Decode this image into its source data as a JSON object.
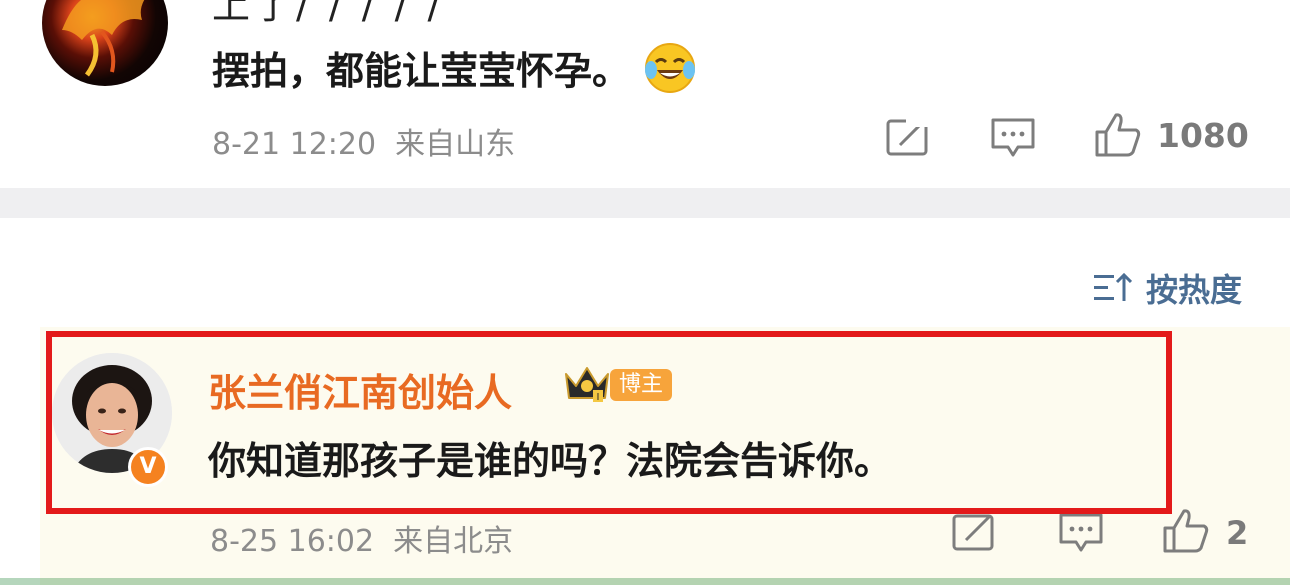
{
  "comment1": {
    "top_partial_text": "上了/ / / / /",
    "text": "摆拍，都能让莹莹怀孕。",
    "emoji": "laughing-crying-emoji",
    "timestamp": "8-21 12:20",
    "location": "来自山东",
    "like_count": "1080"
  },
  "sort": {
    "label": "按热度",
    "icon": "sort-icon"
  },
  "comment2": {
    "author": "张兰俏江南创始人",
    "badge": "博主",
    "verified_mark": "V",
    "text": "你知道那孩子是谁的吗？法院会告诉你。",
    "timestamp": "8-25 16:02",
    "location": "来自北京",
    "like_count": "2"
  },
  "colors": {
    "author_name": "#e86a22",
    "highlight_border": "#e31a1a",
    "sort_text": "#4a6d93",
    "badge_bg": "#f7a43b",
    "comment_bg": "#fdfbef"
  }
}
